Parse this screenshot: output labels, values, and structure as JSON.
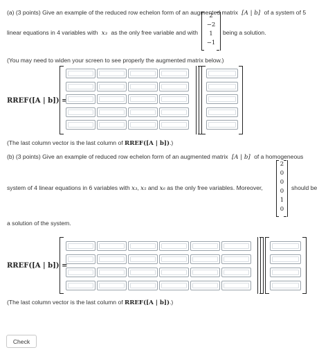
{
  "part_a": {
    "line1_prefix": "(a) (3 points)  Give an example of the reduced row echelon form of an augmented matrix",
    "matrix_notation": "[A | b]",
    "line1_suffix": "of a system of 5",
    "line2_prefix": "linear equations in 4 variables with",
    "free_var": "x₃",
    "line2_mid": "as the only free variable and with",
    "solution_vector": [
      "2",
      "−2",
      "1",
      "−1"
    ],
    "line2_suffix": "being a solution.",
    "widen_note": "(You may need to widen your screen to see properly the augmented matrix below.)",
    "rref_label": "RREF([A | b]) =",
    "rows": 5,
    "coef_cols": 4,
    "footer": "(The last column vector is the last column of",
    "footer_math": "RREF([A | b])",
    "footer_end": ".)"
  },
  "part_b": {
    "line1_prefix": "(b) (3 points)  Give an example of reduced row echelon form of an augmented matrix",
    "matrix_notation": "[A | b]",
    "line1_suffix": "of a homogeneous",
    "line2_prefix": "system of 4 linear equations in 6 variables with",
    "free_vars": [
      "x₃",
      "x₅",
      "x₆"
    ],
    "comma": ",",
    "and": "and",
    "line2_mid": "as the only free variables.  Moreover,",
    "solution_vector": [
      "2",
      "0",
      "0",
      "0",
      "1",
      "0"
    ],
    "line2_suffix": "should be",
    "line3": "a solution of the system.",
    "rref_label": "RREF([A | b]) =",
    "rows": 4,
    "coef_cols": 6,
    "footer": "(The last column vector is the last column of",
    "footer_math": "RREF([A | b])",
    "footer_end": ".)"
  },
  "check_button": "Check"
}
